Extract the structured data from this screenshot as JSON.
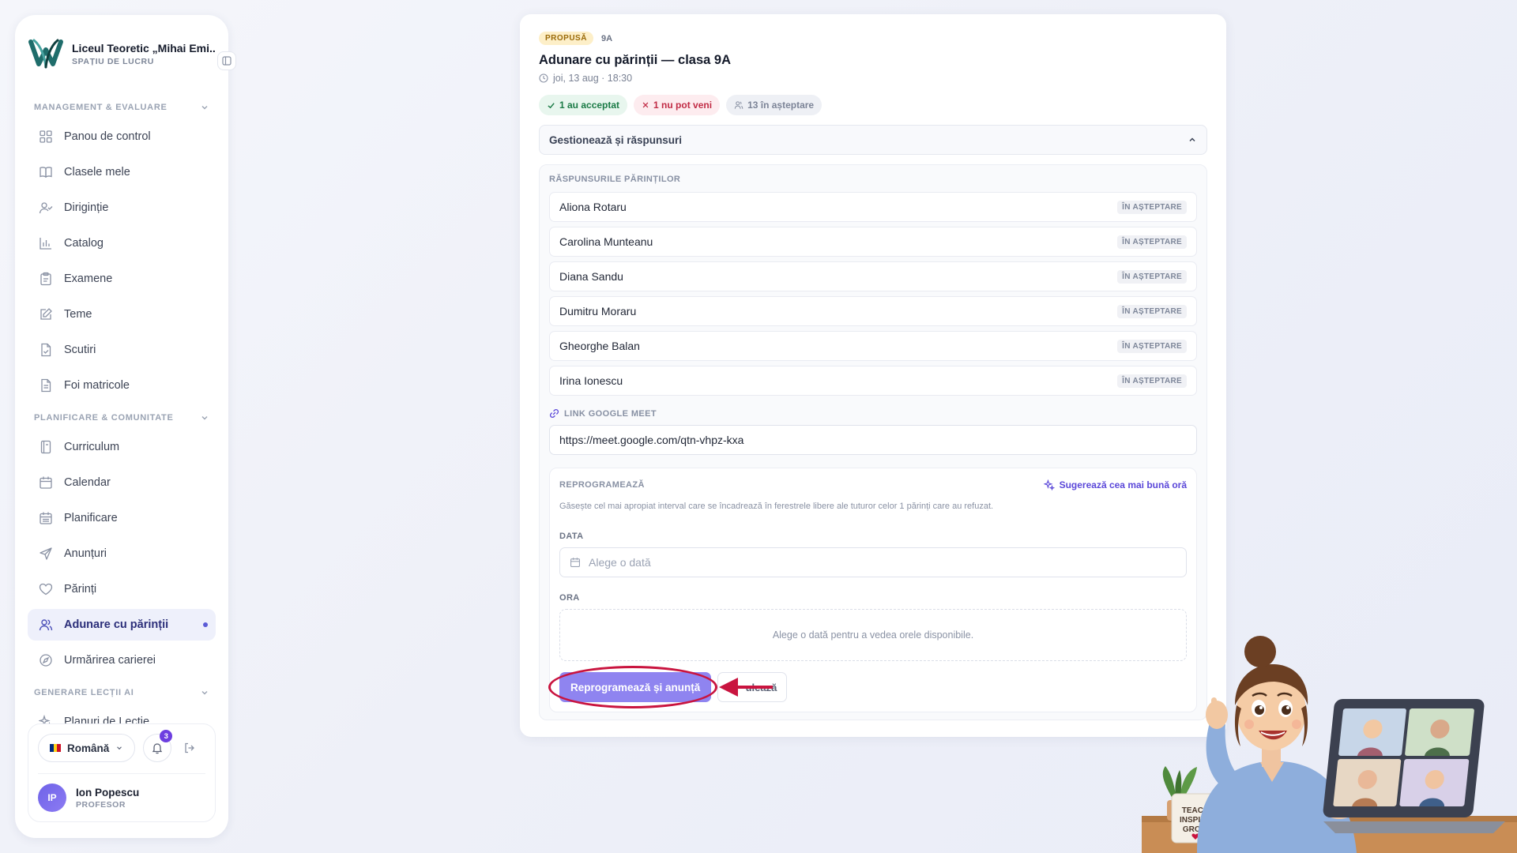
{
  "sidebar": {
    "school_name": "Liceul Teoretic „Mihai Emi...",
    "workspace_label": "SPAȚIU DE LUCRU",
    "sections": [
      {
        "label": "MANAGEMENT & EVALUARE",
        "items": [
          {
            "label": "Panou de control",
            "icon": "dashboard-icon"
          },
          {
            "label": "Clasele mele",
            "icon": "book-icon"
          },
          {
            "label": "Diriginție",
            "icon": "user-check-icon"
          },
          {
            "label": "Catalog",
            "icon": "bar-chart-icon"
          },
          {
            "label": "Examene",
            "icon": "clipboard-icon"
          },
          {
            "label": "Teme",
            "icon": "edit-icon"
          },
          {
            "label": "Scutiri",
            "icon": "file-check-icon"
          },
          {
            "label": "Foi matricole",
            "icon": "file-text-icon"
          }
        ]
      },
      {
        "label": "PLANIFICARE & COMUNITATE",
        "items": [
          {
            "label": "Curriculum",
            "icon": "notebook-icon"
          },
          {
            "label": "Calendar",
            "icon": "calendar-icon"
          },
          {
            "label": "Planificare",
            "icon": "calendar-grid-icon"
          },
          {
            "label": "Anunțuri",
            "icon": "send-icon"
          },
          {
            "label": "Părinți",
            "icon": "heart-icon"
          },
          {
            "label": "Adunare cu părinții",
            "icon": "users-icon",
            "active": true
          },
          {
            "label": "Urmărirea carierei",
            "icon": "compass-icon"
          }
        ]
      },
      {
        "label": "GENERARE LECȚII AI",
        "items": [
          {
            "label": "Planuri de Lecție",
            "icon": "sparkles-icon"
          }
        ]
      }
    ],
    "language": "Română",
    "notifications_count": "3",
    "user": {
      "initials": "IP",
      "name": "Ion Popescu",
      "role": "PROFESOR"
    }
  },
  "meeting": {
    "status": "PROPUSĂ",
    "class": "9A",
    "title": "Adunare cu părinții — clasa 9A",
    "datetime": "joi, 13 aug · 18:30",
    "stats": {
      "accepted": "1 au acceptat",
      "declined": "1 nu pot veni",
      "pending": "13 în așteptare"
    },
    "manage_label": "Gestionează și răspunsuri",
    "responses_label": "RĂSPUNSURILE PĂRINȚILOR",
    "responses": [
      {
        "name": "Aliona Rotaru",
        "status": "ÎN AȘTEPTARE"
      },
      {
        "name": "Carolina Munteanu",
        "status": "ÎN AȘTEPTARE"
      },
      {
        "name": "Diana Sandu",
        "status": "ÎN AȘTEPTARE"
      },
      {
        "name": "Dumitru Moraru",
        "status": "ÎN AȘTEPTARE"
      },
      {
        "name": "Gheorghe Balan",
        "status": "ÎN AȘTEPTARE"
      },
      {
        "name": "Irina Ionescu",
        "status": "ÎN AȘTEPTARE"
      }
    ],
    "meet_label": "LINK GOOGLE MEET",
    "meet_link": "https://meet.google.com/qtn-vhpz-kxa",
    "reschedule": {
      "label": "REPROGRAMEAZĂ",
      "suggest": "Sugerează cea mai bună oră",
      "description": "Găsește cel mai apropiat interval care se încadrează în ferestrele libere ale tuturor celor 1 părinți care au refuzat.",
      "date_label": "DATA",
      "date_placeholder": "Alege o dată",
      "time_label": "ORA",
      "time_hint": "Alege o dată pentru a vedea orele disponibile.",
      "primary_button": "Reprogramează și anunță",
      "secondary_button": "ulează"
    }
  },
  "illustration": {
    "mug_text": [
      "TEACH",
      "INSPIRE",
      "GROW"
    ]
  },
  "colors": {
    "accent": "#5b48d9",
    "primary_button": "#8f84f0",
    "highlight": "#c9143f",
    "accepted": "#1a7a45",
    "declined": "#c12b45"
  }
}
